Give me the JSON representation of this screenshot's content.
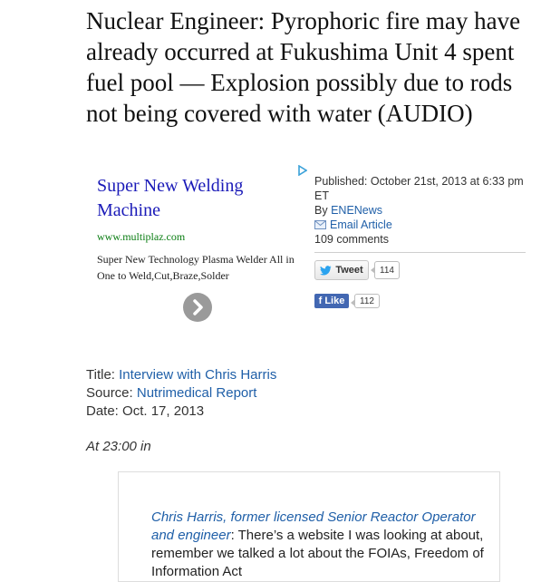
{
  "headline": "Nuclear Engineer: Pyrophoric fire may have already occurred at Fukushima Unit 4 spent fuel pool — Explosion possibly due to rods not being covered with water (AUDIO)",
  "ad": {
    "title": "Super New Welding Machine",
    "url": "www.multiplaz.com",
    "description": "Super New Technology Plasma Welder All in One to Weld,Cut,Braze,Solder",
    "adchoices_icon": "adchoices-icon",
    "arrow_icon": "chevron-right-icon"
  },
  "meta": {
    "published": "Published: October 21st, 2013 at 6:33 pm ET",
    "by_label": "By",
    "author": "ENENews",
    "email_label": "Email Article",
    "comments": "109 comments"
  },
  "social": {
    "tweet_label": "Tweet",
    "tweet_count": "114",
    "like_label": "Like",
    "like_count": "112"
  },
  "info": {
    "title_label": "Title:",
    "title_value": "Interview with Chris Harris",
    "source_label": "Source:",
    "source_value": "Nutrimedical Report",
    "date_label": "Date:",
    "date_value": "Oct. 17, 2013"
  },
  "timestamp": "At 23:00 in",
  "quote": {
    "speaker": "Chris Harris, former licensed Senior Reactor Operator and engineer",
    "text": ": There’s a website I was looking at about, remember we talked a lot about the FOIAs, Freedom of Information Act"
  },
  "colors": {
    "link": "#1f5fa8",
    "ad_title": "#1a1ab8",
    "ad_url": "#0a7d12",
    "facebook": "#4267b2"
  }
}
